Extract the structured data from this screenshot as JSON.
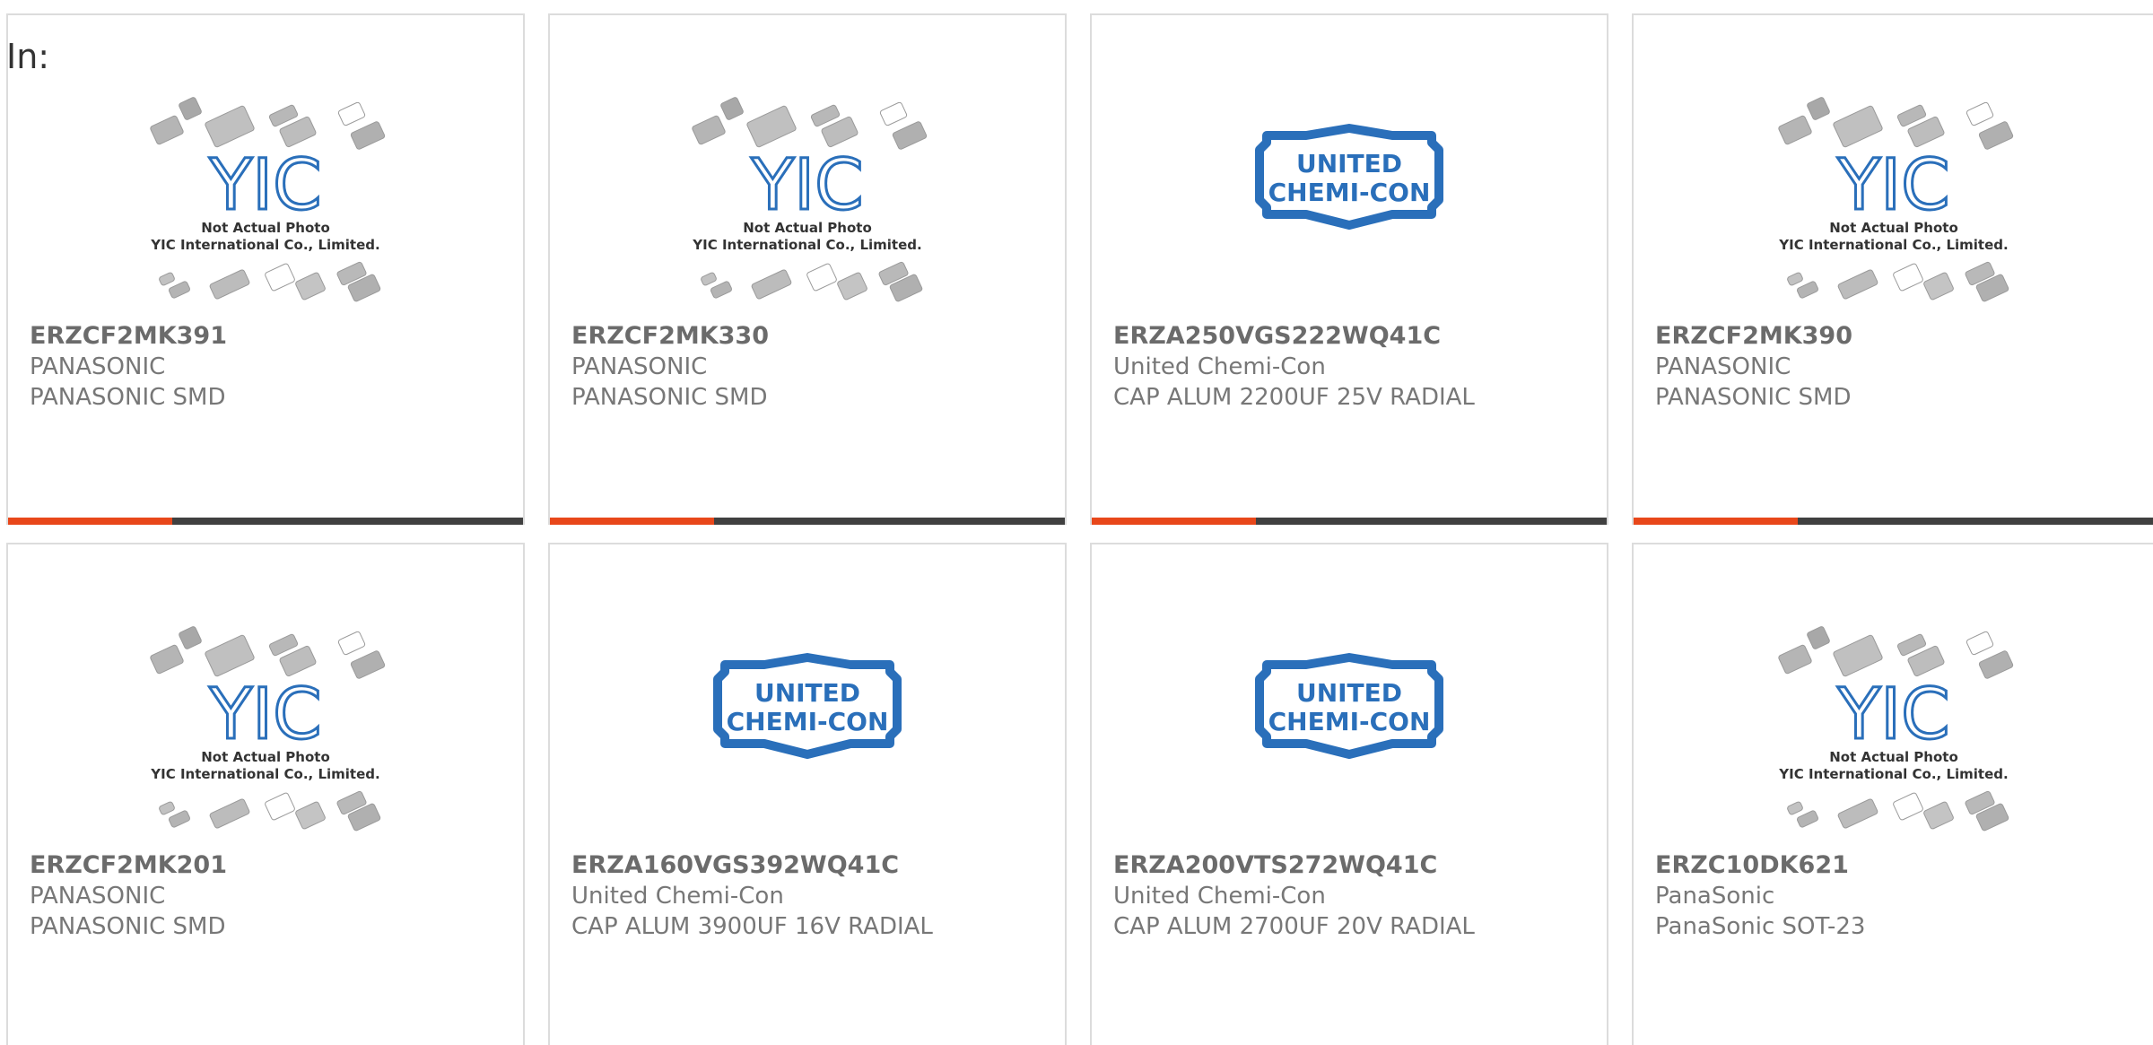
{
  "filter_label": "In:",
  "colors": {
    "accent": "#e8471a",
    "bar": "#404040",
    "logo_blue": "#2a6fba"
  },
  "placeholder_caption": {
    "line1": "Not Actual Photo",
    "line2": "YIC International Co., Limited.",
    "logo_text": "YIC"
  },
  "ucc_logo": {
    "line1": "UNITED",
    "line2": "CHEMI-CON"
  },
  "products": [
    {
      "part": "ERZCF2MK391",
      "brand": "PANASONIC",
      "desc": "PANASONIC SMD",
      "image": "yic-placeholder"
    },
    {
      "part": "ERZCF2MK330",
      "brand": "PANASONIC",
      "desc": "PANASONIC SMD",
      "image": "yic-placeholder"
    },
    {
      "part": "ERZA250VGS222WQ41C",
      "brand": "United Chemi-Con",
      "desc": "CAP ALUM 2200UF 25V RADIAL",
      "image": "united-chemi-con-logo"
    },
    {
      "part": "ERZCF2MK390",
      "brand": "PANASONIC",
      "desc": "PANASONIC SMD",
      "image": "yic-placeholder"
    },
    {
      "part": "ERZCF2MK201",
      "brand": "PANASONIC",
      "desc": "PANASONIC SMD",
      "image": "yic-placeholder"
    },
    {
      "part": "ERZA160VGS392WQ41C",
      "brand": "United Chemi-Con",
      "desc": "CAP ALUM 3900UF 16V RADIAL",
      "image": "united-chemi-con-logo"
    },
    {
      "part": "ERZA200VTS272WQ41C",
      "brand": "United Chemi-Con",
      "desc": "CAP ALUM 2700UF 20V RADIAL",
      "image": "united-chemi-con-logo"
    },
    {
      "part": "ERZC10DK621",
      "brand": "PanaSonic",
      "desc": "PanaSonic SOT-23",
      "image": "yic-placeholder"
    }
  ]
}
